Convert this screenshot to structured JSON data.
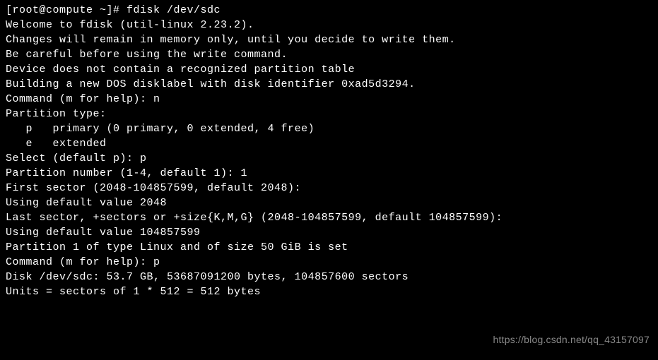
{
  "terminal": {
    "lines": [
      "[root@compute ~]# fdisk /dev/sdc",
      "Welcome to fdisk (util-linux 2.23.2).",
      "",
      "Changes will remain in memory only, until you decide to write them.",
      "Be careful before using the write command.",
      "",
      "Device does not contain a recognized partition table",
      "Building a new DOS disklabel with disk identifier 0xad5d3294.",
      "",
      "Command (m for help): n",
      "Partition type:",
      "   p   primary (0 primary, 0 extended, 4 free)",
      "   e   extended",
      "Select (default p): p",
      "Partition number (1-4, default 1): 1",
      "First sector (2048-104857599, default 2048):",
      "Using default value 2048",
      "Last sector, +sectors or +size{K,M,G} (2048-104857599, default 104857599):",
      "Using default value 104857599",
      "Partition 1 of type Linux and of size 50 GiB is set",
      "",
      "Command (m for help): p",
      "",
      "Disk /dev/sdc: 53.7 GB, 53687091200 bytes, 104857600 sectors",
      "Units = sectors of 1 * 512 = 512 bytes"
    ]
  },
  "watermark": {
    "text": "https://blog.csdn.net/qq_43157097"
  }
}
